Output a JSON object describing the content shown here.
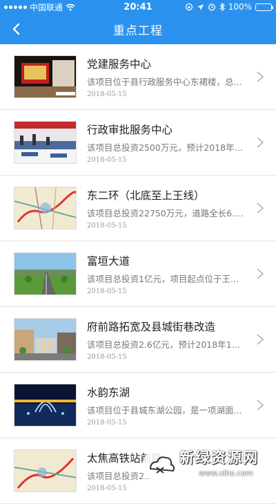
{
  "status": {
    "carrier": "中国联通",
    "time": "20:41",
    "battery": "100%"
  },
  "header": {
    "title": "重点工程"
  },
  "items": [
    {
      "title": "党建服务中心",
      "desc": "该项目位于县行政服务中心东裙楼，总...",
      "date": "2018-05-15"
    },
    {
      "title": "行政审批服务中心",
      "desc": "该项目总投资2500万元，预计2018年6...",
      "date": "2018-05-15"
    },
    {
      "title": "东二环（北底至上王线）",
      "desc": "该项目总投资22750万元，道路全长6.29...",
      "date": "2018-05-15"
    },
    {
      "title": "富垣大道",
      "desc": "该项目总投资1亿元，项目起点位于王...",
      "date": "2018-05-15"
    },
    {
      "title": "府前路拓宽及县城街巷改造",
      "desc": "该项目总投资2.6亿元，预计2018年12月...",
      "date": "2018-05-15"
    },
    {
      "title": "水韵东湖",
      "desc": "该项目位于县城东湖公园，是一项湖面...",
      "date": "2018-05-15"
    },
    {
      "title": "太焦高铁站前路",
      "desc": "该项目总投资2...",
      "date": "2018-05-15"
    }
  ],
  "watermark": {
    "text": "新绿资源网",
    "url": "www.xlhs.com"
  },
  "colors": {
    "header": "#2a92ee"
  }
}
